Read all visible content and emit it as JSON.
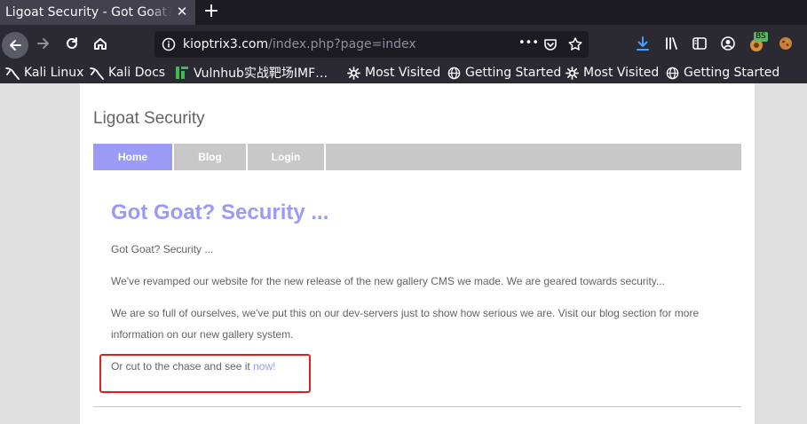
{
  "browser": {
    "tab_title": "Ligoat Security - Got Goat? Security ...",
    "tab_close": "✕",
    "new_tab": "+",
    "url_host": "kioptrix3.com",
    "url_path": "/index.php?page=index",
    "url_more": "•••",
    "extension_badge": "BS",
    "icons": [
      "back-icon",
      "forward-icon",
      "reload-icon",
      "home-icon",
      "site-info-icon",
      "page-actions-icon",
      "pocket-icon",
      "bookmark-star-icon",
      "download-icon",
      "library-icon",
      "sidebar-icon",
      "account-icon",
      "extension-icon",
      "cookie-icon"
    ]
  },
  "bookmarks": [
    {
      "label": "Kali Linux",
      "icon": "kali-icon"
    },
    {
      "label": "Kali Docs",
      "icon": "kali-icon"
    },
    {
      "label": "Vulnhub实战靶场IMF…",
      "icon": "vulnhub-icon"
    },
    {
      "label": "Most Visited",
      "icon": "gear-icon"
    },
    {
      "label": "Getting Started",
      "icon": "globe-icon"
    },
    {
      "label": "Most Visited",
      "icon": "gear-icon"
    },
    {
      "label": "Getting Started",
      "icon": "globe-icon"
    }
  ],
  "site": {
    "title": "Ligoat Security",
    "menu": [
      {
        "label": "Home",
        "active": true
      },
      {
        "label": "Blog",
        "active": false
      },
      {
        "label": "Login",
        "active": false
      }
    ],
    "headline": "Got Goat? Security ...",
    "paragraphs": [
      "Got Goat? Security ...",
      "We've revamped our website for the new release of the new gallery CMS we made. We are geared towards security...",
      "We are so full of ourselves, we've put this on our dev-servers just to show how serious we are. Visit our blog section for more information on our new gallery system."
    ],
    "cta_text": "Or cut to the chase and see it ",
    "cta_link": "now!"
  },
  "colors": {
    "accent": "#9b9bf6",
    "text": "#646464",
    "menu_bg": "#c8c8c8",
    "highlight_box": "#e0201c",
    "chrome_dark": "#2b2a33"
  }
}
